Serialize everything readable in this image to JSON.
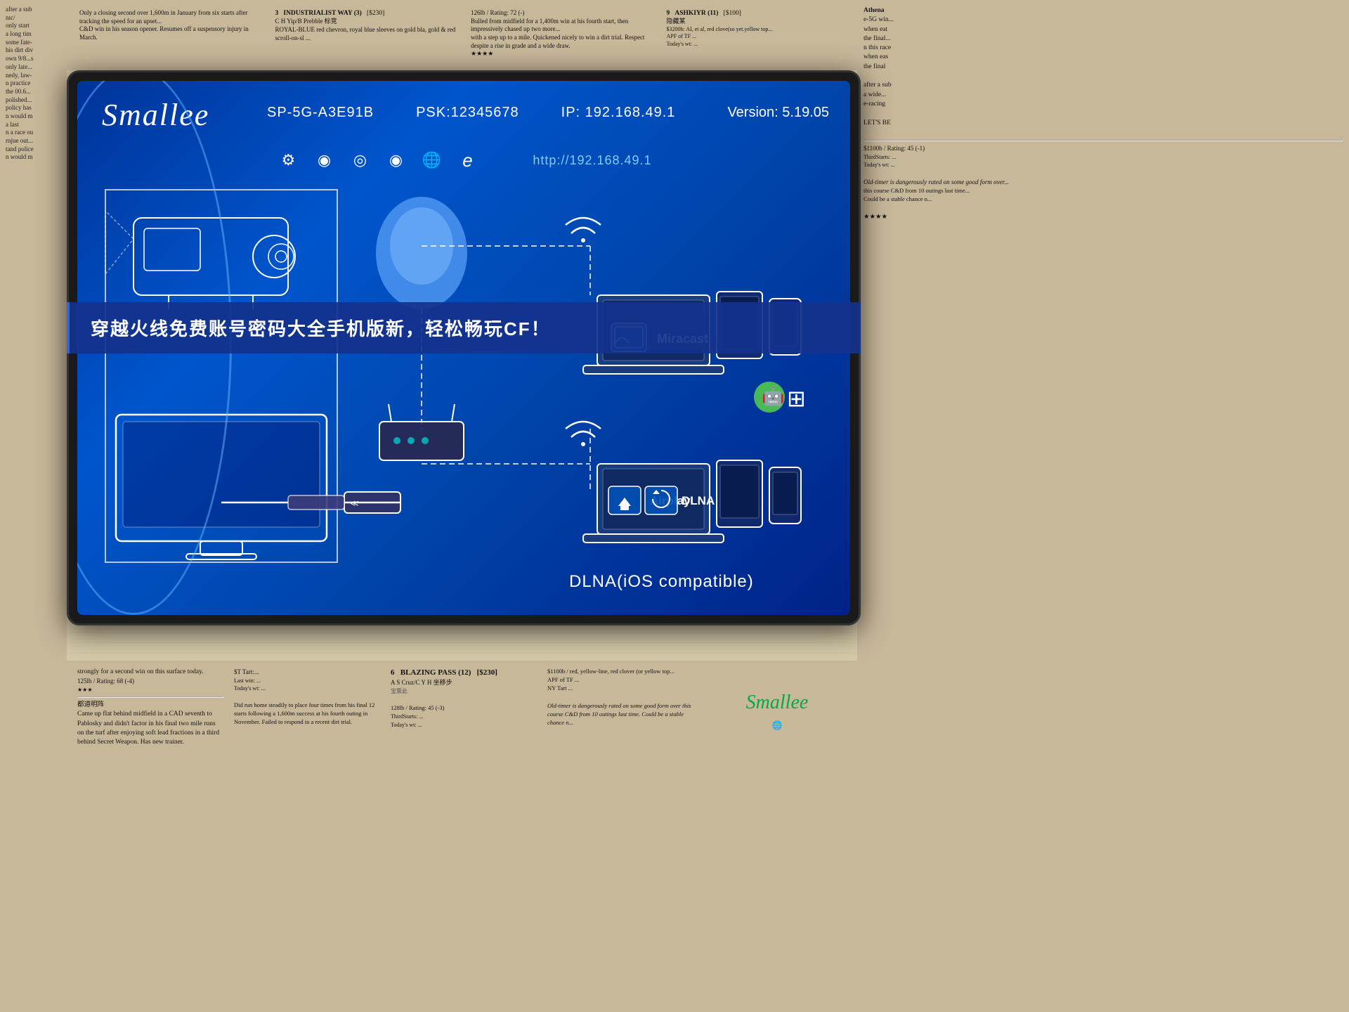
{
  "brand": {
    "name": "Smallee"
  },
  "device": {
    "model": "SP-5G-A3E91B",
    "psk_label": "PSK:",
    "psk": "12345678",
    "ip_label": "IP:",
    "ip": "192.168.49.1",
    "version_label": "Version:",
    "version": "5.19.05",
    "url": "http://192.168.49.1"
  },
  "features": {
    "miracast_label": "Miracast",
    "airplay_label": "Airplay",
    "dlna_label": "DLNA",
    "dlna_compatible": "DLNA(iOS compatible)"
  },
  "banner": {
    "text": "穿越火线免费账号密码大全手机版新，轻松畅玩CF！"
  },
  "icons": {
    "gear": "⚙",
    "circle1": "◎",
    "circle2": "◎",
    "globe": "🌐",
    "ie": "ℯ"
  },
  "newspaper": {
    "headline1": "INDUSTRIALIST WAY (3)",
    "headline2": "ASHKIYR (11)",
    "headline3": "BLAZING PASS (12)"
  }
}
